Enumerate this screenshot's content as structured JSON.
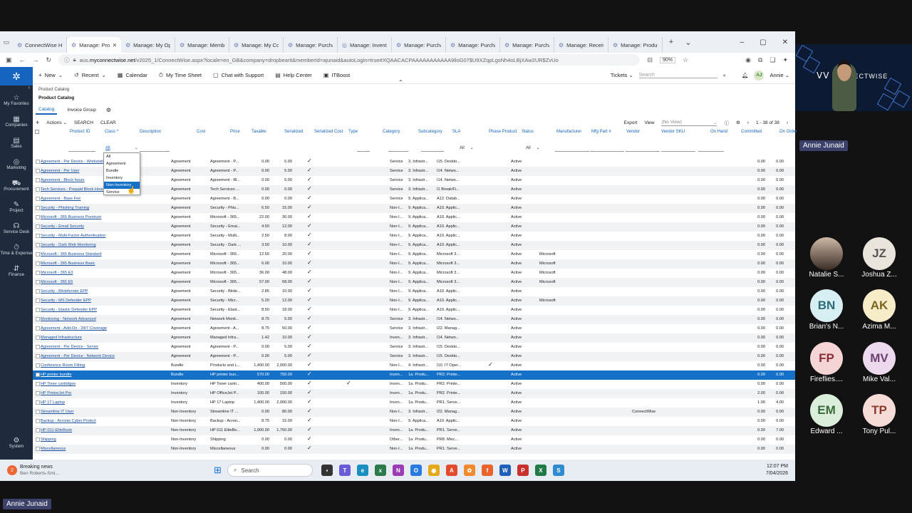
{
  "browser": {
    "tabs": [
      "ConnectWise Hom",
      "Manage: Prod",
      "Manage: My Opp",
      "Manage: Membe",
      "Manage: My Com",
      "Manage: Purchas",
      "Manage: Invento",
      "Manage: Purchas",
      "Manage: Purchas",
      "Manage: Purchas",
      "Manage: Receivi",
      "Manage: Product"
    ],
    "url_prefix": "aus.",
    "url_domain": "myconnectwise.net",
    "url_rest": "/v2025_1/ConnectWise.aspx?locale=en_GB&company=dropbearit&memberId=ajunaid&autoLogin=true#XQAACACPAAAAAAAAAAA9iloG07$U9XZqpLgsNh4oLBjXAw2UR$ZvUo",
    "zoom": "90%"
  },
  "sidebar": [
    {
      "icon": "☆",
      "label": "My Favorites"
    },
    {
      "icon": "▦",
      "label": "Companies"
    },
    {
      "icon": "▤",
      "label": "Sales"
    },
    {
      "icon": "◎",
      "label": "Marketing"
    },
    {
      "icon": "⛟",
      "label": "Procurement"
    },
    {
      "icon": "✎",
      "label": "Project"
    },
    {
      "icon": "☊",
      "label": "Service Desk"
    },
    {
      "icon": "⏱",
      "label": "Time & Expense"
    },
    {
      "icon": "⇵",
      "label": "Finance"
    }
  ],
  "sidebar_system": "System",
  "topnav": {
    "new": "New",
    "recent": "Recent",
    "calendar": "Calendar",
    "timesheet": "My Time Sheet",
    "chat": "Chat with Support",
    "help": "Help Center",
    "itboost": "ITBoost",
    "tickets": "Tickets",
    "search": "Search",
    "avatar": "AJ",
    "user": "Annie"
  },
  "breadcrumb": "Product Catalog",
  "page_title": "Product Catalog",
  "subtabs": {
    "catalog": "Catalog",
    "invoice_group": "Invoice Group"
  },
  "toolbar": {
    "actions": "Actions",
    "search": "SEARCH",
    "clear": "CLEAR",
    "export": "Export",
    "view": "View",
    "no_view": "(No View)",
    "pager": "1 - 38 of 38"
  },
  "columns": [
    "Product ID",
    "Class ^",
    "Description",
    "Cost",
    "Price",
    "Taxable",
    "Serialized",
    "Serialized Cost",
    "Type",
    "Category",
    "Subcategory",
    "SLA",
    "Phase Product",
    "Status",
    "Manufacturer",
    "Mfg Part #",
    "Vendor",
    "Vendor SKU",
    "On Hand",
    "Committed",
    "On Order"
  ],
  "filters": {
    "class_value": "All",
    "sla": "All",
    "status": "All"
  },
  "class_options": [
    "All",
    "Agreement",
    "Bundle",
    "Inventory",
    "Non-Inventory",
    "Service"
  ],
  "rows": [
    [
      "Agreement - Per Device - Workstation",
      "Agreement",
      "Agreement - P...",
      "0.00",
      "5.00",
      "Service",
      "3. Infrastr...",
      "I15. Deskto...",
      "Active",
      "",
      "",
      "0.00",
      "0.00"
    ],
    [
      "Agreement - Per User",
      "Agreement",
      "Agreement - P...",
      "0.00",
      "5.00",
      "Service",
      "3. Infrastr...",
      "I14. Netwo...",
      "Active",
      "",
      "",
      "0.00",
      "0.00"
    ],
    [
      "Agreement - Block hours",
      "Agreement",
      "Agreement - Bl...",
      "0.00",
      "5.00",
      "Service",
      "3. Infrastr...",
      "I14. Netwo...",
      "Active",
      "",
      "",
      "0.00",
      "0.00"
    ],
    [
      "Tech Services - Prepaid Block Hours",
      "Agreement",
      "Tech Services ...",
      "0.00",
      "0.00",
      "Service",
      "3. Infrastr...",
      "I1 Break/Fi...",
      "Active",
      "",
      "",
      "0.00",
      "0.00"
    ],
    [
      "Agreement - Base Fee",
      "Agreement",
      "Agreement - B...",
      "0.00",
      "0.00",
      "Service",
      "9. Applica...",
      "A12. Datab...",
      "Active",
      "",
      "",
      "0.00",
      "0.00"
    ],
    [
      "Security - Phishing Training",
      "Agreement",
      "Security - Phis...",
      "6.50",
      "15.00",
      "Non-I...",
      "9. Applica...",
      "A10. Applic...",
      "Active",
      "",
      "",
      "0.00",
      "0.00"
    ],
    [
      "Microsoft - 365 Business Premium",
      "Agreement",
      "Microsoft - 365...",
      "22.00",
      "30.00",
      "Non-I...",
      "9. Applica...",
      "A10. Applic...",
      "Active",
      "",
      "",
      "0.00",
      "0.00"
    ],
    [
      "Security - Email Security",
      "Agreement",
      "Security - Emai...",
      "4.50",
      "12.00",
      "Non-I...",
      "9. Applica...",
      "A10. Applic...",
      "Active",
      "",
      "",
      "0.00",
      "0.00"
    ],
    [
      "Security - Multi-Factor Authentication",
      "Agreement",
      "Security - Multi...",
      "2.50",
      "8.00",
      "Non-I...",
      "9. Applica...",
      "A10. Applic...",
      "Active",
      "",
      "",
      "0.00",
      "0.00"
    ],
    [
      "Security - Dark Web Monitoring",
      "Agreement",
      "Security - Dark ...",
      "3.50",
      "10.00",
      "Non-I...",
      "9. Applica...",
      "A10. Applic...",
      "Active",
      "",
      "",
      "0.00",
      "0.00"
    ],
    [
      "Microsoft - 365 Business Standard",
      "Agreement",
      "Microsoft - 365...",
      "12.50",
      "20.00",
      "Non-I...",
      "9. Applica...",
      "Microsoft 3...",
      "Active",
      "Microsoft",
      "",
      "0.00",
      "0.00"
    ],
    [
      "Microsoft - 365 Business Basic",
      "Agreement",
      "Microsoft - 365...",
      "6.00",
      "10.00",
      "Non-I...",
      "9. Applica...",
      "Microsoft 3...",
      "Active",
      "Microsoft",
      "",
      "0.00",
      "0.00"
    ],
    [
      "Microsoft - 365 E3",
      "Agreement",
      "Microsoft - 365...",
      "36.00",
      "48.00",
      "Non-I...",
      "9. Applica...",
      "Microsoft 3...",
      "Active",
      "Microsoft",
      "",
      "0.00",
      "0.00"
    ],
    [
      "Microsoft - 365 E5",
      "Agreement",
      "Microsoft - 365...",
      "57.00",
      "68.00",
      "Non-I...",
      "9. Applica...",
      "Microsoft 3...",
      "Active",
      "Microsoft",
      "",
      "0.00",
      "0.00"
    ],
    [
      "Security - Bitdefender EPP",
      "Agreement",
      "Security - Bitde...",
      "2.85",
      "10.00",
      "Non-I...",
      "9. Applica...",
      "A10. Applic...",
      "Active",
      "",
      "",
      "0.00",
      "0.00"
    ],
    [
      "Security - MS Defender EPP",
      "Agreement",
      "Security - Micr...",
      "5.20",
      "12.00",
      "Non-I...",
      "9. Applica...",
      "A10. Applic...",
      "Active",
      "Microsoft",
      "",
      "0.00",
      "0.00"
    ],
    [
      "Security - Elastic Defender EPP",
      "Agreement",
      "Security - Elast...",
      "8.50",
      "18.00",
      "Non-I...",
      "9. Applica...",
      "A10. Applic...",
      "Active",
      "",
      "",
      "0.00",
      "0.00"
    ],
    [
      "Monitoring - Network Advanced",
      "Agreement",
      "Network Monit...",
      "8.75",
      "5.00",
      "Service",
      "3. Infrastr...",
      "I14. Netwo...",
      "Active",
      "",
      "",
      "0.00",
      "0.00"
    ],
    [
      "Agreement - Add-On - 24/7 Coverage",
      "Agreement",
      "Agreement - A...",
      "8.75",
      "50.00",
      "Service",
      "3. Infrastr...",
      "I22. Manag...",
      "Active",
      "",
      "",
      "0.00",
      "0.00"
    ],
    [
      "Managed Infrastructure",
      "Agreement",
      "Managed Infra...",
      "1.42",
      "10.00",
      "Inven...",
      "3. Infrastr...",
      "I14. Netwo...",
      "Active",
      "",
      "",
      "0.00",
      "0.00"
    ],
    [
      "Agreement - Per Device - Server",
      "Agreement",
      "Agreement - P...",
      "0.00",
      "5.00",
      "Service",
      "3. Infrastr...",
      "I15. Deskto...",
      "Active",
      "",
      "",
      "0.00",
      "0.00"
    ],
    [
      "Agreement - Per Device - Network Device",
      "Agreement",
      "Agreement - P...",
      "0.00",
      "5.00",
      "Service",
      "3. Infrastr...",
      "I15. Deskto...",
      "Active",
      "",
      "",
      "0.00",
      "0.00"
    ],
    [
      "Conference Room Fitting",
      "Bundle",
      "Products and L...",
      "1,400.00",
      "2,900.00",
      "Non-I...",
      "4. Infrastr...",
      "I10. IT Oper...",
      "Active",
      "",
      "",
      "0.00",
      "0.00"
    ],
    [
      "HP printer bundle",
      "Bundle",
      "HP printer bun...",
      "570.00",
      "750.00",
      "Inven...",
      "1a. Produ...",
      "PR2. Printe...",
      "Active",
      "",
      "",
      "0.00",
      "0.00"
    ],
    [
      "HP Toner cartridges",
      "Inventory",
      "HP Toner cartri...",
      "400.00",
      "500.00",
      "Inven...",
      "1a. Produ...",
      "PR2. Printe...",
      "Active",
      "",
      "",
      "0.00",
      "0.00"
    ],
    [
      "HP PrinterJet Pro",
      "Inventory",
      "HP OfficeJet P...",
      "100.00",
      "150.00",
      "Inven...",
      "1a. Produ...",
      "PR2. Printe...",
      "Active",
      "",
      "",
      "2.00",
      "0.00"
    ],
    [
      "HP 17 Laptop",
      "Inventory",
      "HP 17 Laptop",
      "1,400.00",
      "2,000.00",
      "Inven...",
      "1a. Produ...",
      "PR1. Serve...",
      "Active",
      "",
      "",
      "1.00",
      "4.00"
    ],
    [
      "Streamline IT User",
      "Non-Inventory",
      "Streamline IT ...",
      "0.00",
      "80.00",
      "Non-I...",
      "3. Infrastr...",
      "I22. Manag...",
      "Active",
      "",
      "ConnectWise",
      "0.00",
      "0.00"
    ],
    [
      "Backup - Acronis Cyber Protect",
      "Non-Inventory",
      "Backup - Acron...",
      "8.75",
      "15.00",
      "Non-I...",
      "9. Applica...",
      "A10. Applic...",
      "Active",
      "",
      "",
      "0.00",
      "0.00"
    ],
    [
      "HP-011-EliteBook",
      "Non-Inventory",
      "HP 011 EliteBo...",
      "1,000.00",
      "1,750.00",
      "Inven...",
      "1a. Produ...",
      "PR1. Serve...",
      "Active",
      "",
      "",
      "0.00",
      "7.00"
    ],
    [
      "Shipping",
      "Non-Inventory",
      "Shipping",
      "0.00",
      "0.00",
      "Other...",
      "1a. Produ...",
      "PR8. Misc...",
      "Active",
      "",
      "",
      "0.00",
      "0.00"
    ],
    [
      "Miscellaneous",
      "Non-Inventory",
      "Miscellaneous",
      "0.00",
      "0.00",
      "Non-I...",
      "1a. Produ...",
      "PR1. Serve...",
      "Active",
      "",
      "",
      "0.00",
      "0.00"
    ]
  ],
  "taskbar": {
    "news_title": "Breaking news",
    "news_sub": "Ben Roberts-Smi...",
    "search": "Search",
    "time": "12:07 PM",
    "date": "7/04/2026"
  },
  "video": {
    "brand": "CONNECTWISE",
    "presenter": "Annie Junaid"
  },
  "participants": [
    {
      "initials": "",
      "name": "Natalie S...",
      "bg": "#ffffff",
      "fg": "#333333"
    },
    {
      "initials": "JZ",
      "name": "Joshua Z...",
      "bg": "#e9e4dc",
      "fg": "#5a5550"
    },
    {
      "initials": "BN",
      "name": "Brian's N...",
      "bg": "#d7eef3",
      "fg": "#2b6b7a"
    },
    {
      "initials": "AK",
      "name": "Azima M...",
      "bg": "#f6ecc8",
      "fg": "#7a6420"
    },
    {
      "initials": "FP",
      "name": "Fireflies....",
      "bg": "#f5d4d6",
      "fg": "#8a2c35"
    },
    {
      "initials": "MV",
      "name": "Mike Val...",
      "bg": "#ecd9ee",
      "fg": "#6d3f73"
    },
    {
      "initials": "EM",
      "name": "Edward ...",
      "bg": "#dbeedb",
      "fg": "#3a6a3a"
    },
    {
      "initials": "TP",
      "name": "Tony Pul...",
      "bg": "#f6dcd6",
      "fg": "#8a3a2c"
    }
  ],
  "self_label": "Annie Junaid"
}
